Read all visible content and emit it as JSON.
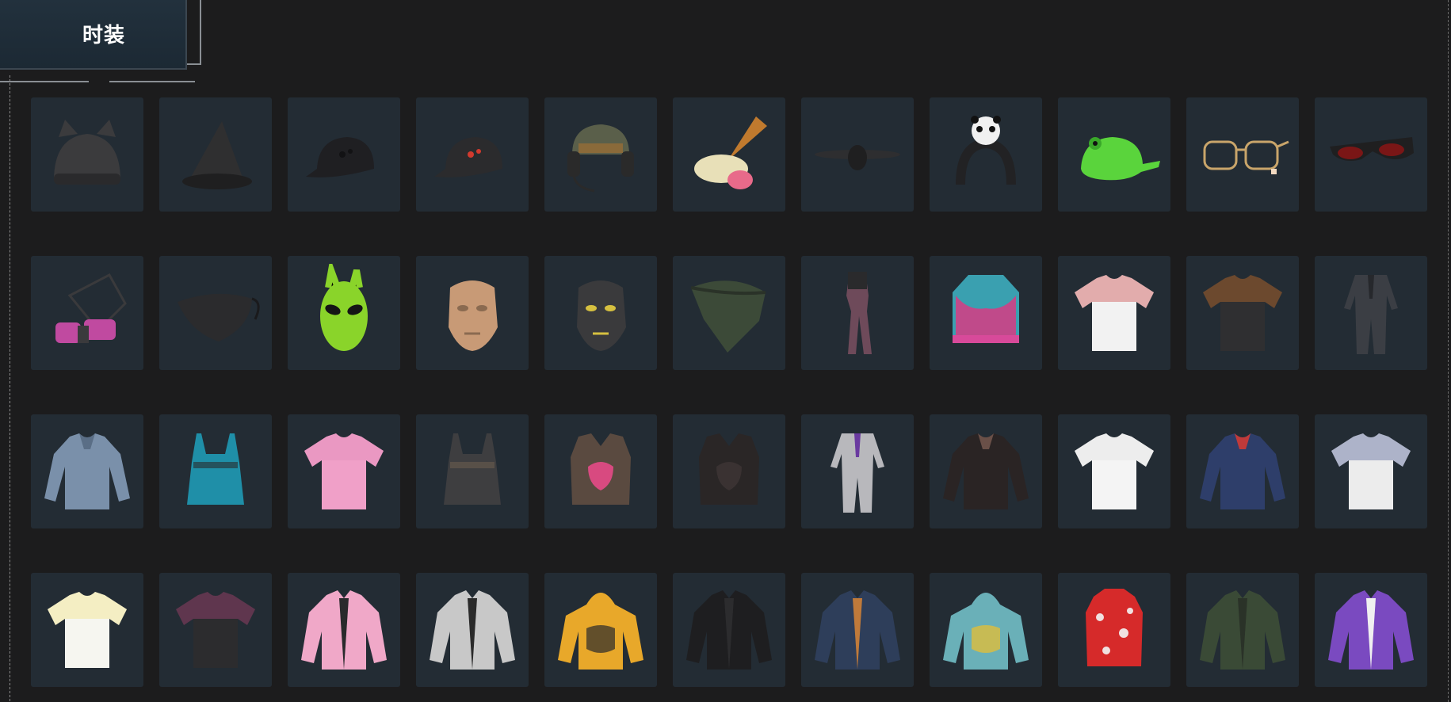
{
  "header": {
    "title": "时装"
  },
  "colors": {
    "background": "#1c1c1d",
    "tile": "#232c34",
    "title_tab": "#22313d"
  },
  "items": [
    {
      "name": "cat-ear-beanie-icon",
      "kind": "beanie",
      "c1": "#3b3b3d",
      "c2": "#2a2a2c"
    },
    {
      "name": "witch-hat-icon",
      "kind": "witch",
      "c1": "#2f2f30",
      "c2": "#1f1f20"
    },
    {
      "name": "black-bucket-cap-icon",
      "kind": "cap",
      "c1": "#1f1f22",
      "c2": "#121214"
    },
    {
      "name": "black-baseball-cap-icon",
      "kind": "cap",
      "c1": "#2b2b2d",
      "c2": "#d23a2e"
    },
    {
      "name": "headset-helmet-icon",
      "kind": "headset",
      "c1": "#5a5f4a",
      "c2": "#2a2a2a"
    },
    {
      "name": "ice-cream-cone-hat-icon",
      "kind": "icecream",
      "c1": "#e8e0b8",
      "c2": "#c07a2e"
    },
    {
      "name": "dark-propeller-hat-icon",
      "kind": "flat",
      "c1": "#2e2e30",
      "c2": "#1f1f20"
    },
    {
      "name": "panda-headband-icon",
      "kind": "headband",
      "c1": "#222224",
      "c2": "#f0f0f0"
    },
    {
      "name": "green-frog-cap-icon",
      "kind": "frog",
      "c1": "#5ad43c",
      "c2": "#3aa82a"
    },
    {
      "name": "gold-glasses-icon",
      "kind": "glasses",
      "c1": "#c9a56a",
      "c2": "#f2d9c0"
    },
    {
      "name": "red-sunglasses-icon",
      "kind": "sunglasses",
      "c1": "#1f1f20",
      "c2": "#7a1616"
    },
    {
      "name": "gas-mask-icon",
      "kind": "gasmask",
      "c1": "#3a3a3c",
      "c2": "#c04aa0"
    },
    {
      "name": "black-face-mask-icon",
      "kind": "facemask",
      "c1": "#2b2b2d",
      "c2": "#1a1a1c"
    },
    {
      "name": "green-alien-mask-icon",
      "kind": "alien",
      "c1": "#8ad42a",
      "c2": "#151515"
    },
    {
      "name": "human-face-mask-icon",
      "kind": "face",
      "c1": "#c89a76",
      "c2": "#8a6a50"
    },
    {
      "name": "crash-test-mask-icon",
      "kind": "face",
      "c1": "#3a3a3c",
      "c2": "#d6c040"
    },
    {
      "name": "camo-bandana-icon",
      "kind": "bandana",
      "c1": "#3c4a38",
      "c2": "#2a3228"
    },
    {
      "name": "bodysuit-icon",
      "kind": "bodysuit",
      "c1": "#6e4a5a",
      "c2": "#2a2a2c"
    },
    {
      "name": "graffiti-sports-bra-icon",
      "kind": "bra",
      "c1": "#c04a8a",
      "c2": "#3aa0b0"
    },
    {
      "name": "red-white-polo-icon",
      "kind": "tshirt",
      "c1": "#f2f2f2",
      "c2": "#c62b2b"
    },
    {
      "name": "dark-graphic-tee-icon",
      "kind": "tshirt",
      "c1": "#2f2f31",
      "c2": "#e07a2a"
    },
    {
      "name": "leather-jumpsuit-icon",
      "kind": "jumpsuit",
      "c1": "#3b3e44",
      "c2": "#26282c"
    },
    {
      "name": "denim-shirt-icon",
      "kind": "longshirt",
      "c1": "#7a90aa",
      "c2": "#5a6e86"
    },
    {
      "name": "blue-lace-cami-icon",
      "kind": "cami",
      "c1": "#1f8fa8",
      "c2": "#2a2a2c"
    },
    {
      "name": "pink-tee-icon",
      "kind": "tshirt",
      "c1": "#f0a0c8",
      "c2": "#e08ab6"
    },
    {
      "name": "tactical-crop-top-icon",
      "kind": "cami",
      "c1": "#3e3e40",
      "c2": "#6a5e4e"
    },
    {
      "name": "heart-armor-vest-icon",
      "kind": "vest",
      "c1": "#5a4a40",
      "c2": "#d84a80"
    },
    {
      "name": "black-tactical-vest-icon",
      "kind": "vest",
      "c1": "#2a2626",
      "c2": "#3a3232"
    },
    {
      "name": "patterned-suit-icon",
      "kind": "jumpsuit",
      "c1": "#b8b8bc",
      "c2": "#6a3aa0"
    },
    {
      "name": "mesh-crop-top-icon",
      "kind": "longshirt",
      "c1": "#2a2424",
      "c2": "#6a5048"
    },
    {
      "name": "white-crop-tee-icon",
      "kind": "tshirt",
      "c1": "#f4f4f4",
      "c2": "#e0e0e0"
    },
    {
      "name": "navy-sweater-icon",
      "kind": "longshirt",
      "c1": "#2e3e6a",
      "c2": "#c03a3a"
    },
    {
      "name": "sunshine-tee-icon",
      "kind": "tshirt",
      "c1": "#ececec",
      "c2": "#3a4a8a"
    },
    {
      "name": "yellow-raglan-tee-icon",
      "kind": "tshirt",
      "c1": "#f6f6f0",
      "c2": "#f2e070"
    },
    {
      "name": "black-crop-tee-icon",
      "kind": "tshirt",
      "c1": "#2c2c2e",
      "c2": "#c04a8a"
    },
    {
      "name": "pink-crop-jacket-icon",
      "kind": "jacket",
      "c1": "#f0a8c8",
      "c2": "#2a2a2c"
    },
    {
      "name": "silver-bomber-jacket-icon",
      "kind": "jacket",
      "c1": "#c8c8c8",
      "c2": "#2a2a2a"
    },
    {
      "name": "yellow-hoodie-icon",
      "kind": "hoodie",
      "c1": "#e8a82a",
      "c2": "#2a2a2c"
    },
    {
      "name": "black-jacket-icon",
      "kind": "jacket",
      "c1": "#1e1e20",
      "c2": "#2c2c2e"
    },
    {
      "name": "denim-jacket-icon",
      "kind": "jacket",
      "c1": "#2e3e5a",
      "c2": "#c07a3a"
    },
    {
      "name": "teal-duck-hoodie-icon",
      "kind": "hoodie",
      "c1": "#6ab0b8",
      "c2": "#f0c02a"
    },
    {
      "name": "red-floral-vest-icon",
      "kind": "puffer",
      "c1": "#d62a2a",
      "c2": "#f0e0e0"
    },
    {
      "name": "green-bomber-jacket-icon",
      "kind": "jacket",
      "c1": "#3a4a36",
      "c2": "#2a3228"
    },
    {
      "name": "purple-colorblock-jacket-icon",
      "kind": "jacket",
      "c1": "#7a4ac0",
      "c2": "#f0f0f0"
    }
  ]
}
